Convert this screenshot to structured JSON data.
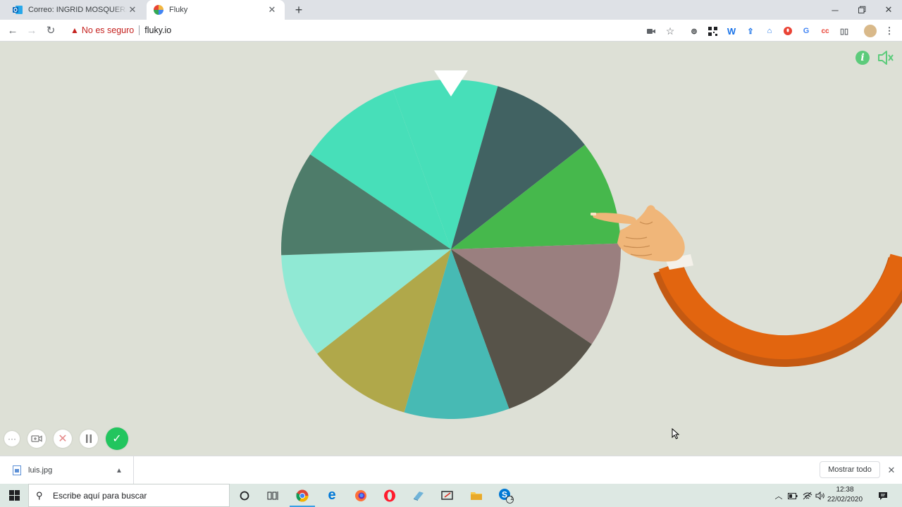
{
  "browser": {
    "tabs": [
      {
        "title": "Correo: INGRID MOSQUERA GENERAL - Outlook",
        "favicon": "outlook-icon",
        "active": false
      },
      {
        "title": "Fluky",
        "favicon": "fluky-icon",
        "active": true
      }
    ],
    "address": {
      "security_label": "No es seguro",
      "url": "fluky.io"
    },
    "window_controls": [
      "minimize-icon",
      "maximize-icon",
      "close-icon"
    ],
    "extensions": [
      "camera-icon",
      "star-icon",
      "ext-circle-icon",
      "qr-icon",
      "w-icon",
      "upload-icon",
      "cap-icon",
      "mic-icon",
      "translate-icon",
      "cc-icon",
      "reader-icon",
      "profile-avatar"
    ]
  },
  "page": {
    "wheel": {
      "segments": 10,
      "colors": [
        "#47dfb9",
        "#416262",
        "#46b84c",
        "#9a7f7f",
        "#575349",
        "#47bab4",
        "#b0a84a",
        "#90e9d4",
        "#4e7c6a",
        "#47dfb9"
      ],
      "pointer_color": "#ffffff"
    },
    "arm_color": "#e2650f",
    "skin_color": "#f0b679",
    "info_color": "#5ccb7b",
    "recorder_buttons": [
      "more-icon",
      "camera-toggle-icon",
      "cancel-icon",
      "pause-icon",
      "done-icon"
    ]
  },
  "downloads": {
    "item": {
      "name": "luis.jpg"
    },
    "show_all": "Mostrar todo"
  },
  "taskbar": {
    "search_placeholder": "Escribe aquí para buscar",
    "apps": [
      "cortana-icon",
      "task-view-icon",
      "chrome-icon",
      "edge-icon",
      "firefox-icon",
      "opera-icon",
      "app-icon",
      "snip-icon",
      "files-icon",
      "skype-icon"
    ],
    "skype_badge": "1",
    "time": "12:38",
    "date": "22/02/2020"
  }
}
